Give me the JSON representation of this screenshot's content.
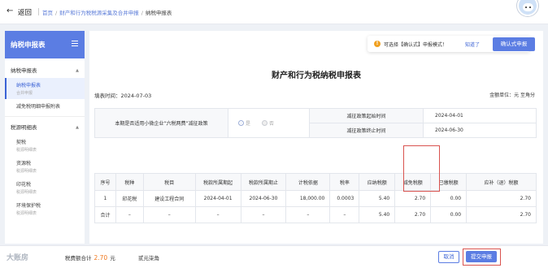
{
  "header": {
    "back_label": "返回",
    "breadcrumb": [
      "首页",
      "财产和行为税税源采集及合并申报",
      "纳税申报表"
    ]
  },
  "sidebar": {
    "title": "纳税申报表",
    "sections": [
      {
        "label": "纳税申报表",
        "items": [
          {
            "label": "纳税申报表",
            "sub": "合并申报",
            "active": true
          },
          {
            "label": "减免税明细申报附表",
            "sub": "",
            "active": false
          }
        ]
      },
      {
        "label": "税源明细表",
        "items": [
          {
            "label": "契税",
            "sub": "税源明细表"
          },
          {
            "label": "资源税",
            "sub": "税源明细表"
          },
          {
            "label": "印花税",
            "sub": "税源明细表"
          },
          {
            "label": "环境保护税",
            "sub": "税源明细表"
          }
        ]
      }
    ]
  },
  "hint": {
    "text": "可选择【确认式】申报模式！",
    "link": "知道了"
  },
  "confirm_button": "确认式申报",
  "form": {
    "title": "财产和行为税纳税申报表",
    "fill_date_label": "填表时间：",
    "fill_date": "2024-07-03",
    "unit": "金额单位：元  至角分",
    "policy_question": "本期是否适用小微企业“六税两费”减征政策",
    "radio_yes": "是",
    "radio_no": "否",
    "start_label": "减征政策起始时间",
    "start_value": "2024-04-01",
    "end_label": "减征政策终止时间",
    "end_value": "2024-06-30"
  },
  "table": {
    "headers": [
      "序号",
      "税种",
      "税目",
      "税款所属期起",
      "税款所属期止",
      "计税依据",
      "税率",
      "应纳税额",
      "减免税额",
      "已缴税额",
      "应补（退）税额"
    ],
    "rows": [
      [
        "1",
        "印花税",
        "建设工程合同",
        "2024-04-01",
        "2024-06-30",
        "18,000.00",
        "0.0003",
        "5.40",
        "2.70",
        "0.00",
        "2.70"
      ],
      [
        "合计",
        "–",
        "–",
        "–",
        "–",
        "–",
        "–",
        "5.40",
        "2.70",
        "0.00",
        "2.70"
      ]
    ]
  },
  "footer": {
    "watermark": "大账房",
    "total_label": "税费额合计",
    "total_value": "2.70",
    "total_unit": "元",
    "total_words": "贰元柒角",
    "cancel": "取消",
    "submit": "提交申报"
  }
}
